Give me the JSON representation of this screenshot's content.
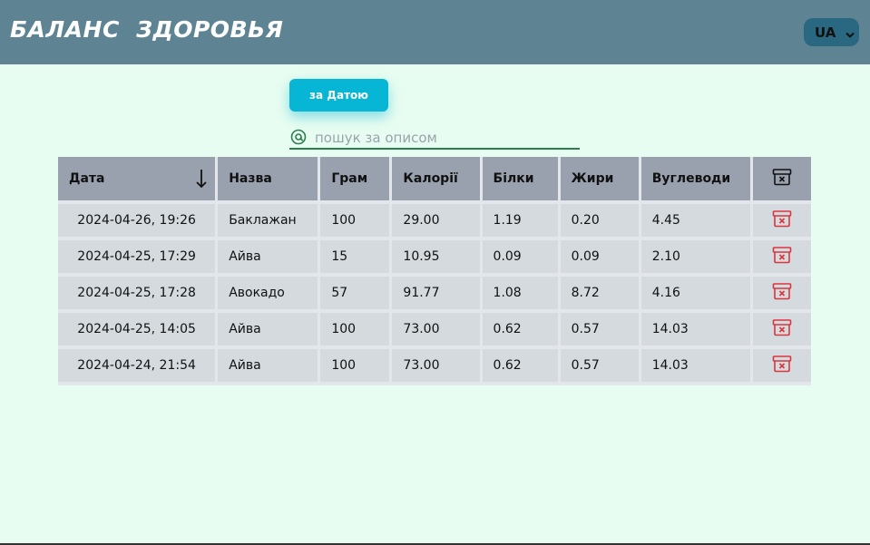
{
  "header": {
    "title": "БАЛАНС  ЗДОРОВЬЯ",
    "lang": "UA"
  },
  "controls": {
    "sort_button": "за Датою",
    "search_placeholder": "пошук за описом"
  },
  "table": {
    "columns": [
      "Дата",
      "Назва",
      "Грам",
      "Калорії",
      "Білки",
      "Жири",
      "Вуглеводи"
    ],
    "rows": [
      [
        "2024-04-26, 19:26",
        "Баклажан",
        "100",
        "29.00",
        "1.19",
        "0.20",
        "4.45"
      ],
      [
        "2024-04-25, 17:29",
        "Айва",
        "15",
        "10.95",
        "0.09",
        "0.09",
        "2.10"
      ],
      [
        "2024-04-25, 17:28",
        "Авокадо",
        "57",
        "91.77",
        "1.08",
        "8.72",
        "4.16"
      ],
      [
        "2024-04-25, 14:05",
        "Айва",
        "100",
        "73.00",
        "0.62",
        "0.57",
        "14.03"
      ],
      [
        "2024-04-24, 21:54",
        "Айва",
        "100",
        "73.00",
        "0.62",
        "0.57",
        "14.03"
      ]
    ]
  },
  "colors": {
    "header_bg": "#5e8493",
    "accent": "#06b6d4",
    "delete": "#d9363e",
    "page_bg": "#e8fdf1"
  },
  "icons": {
    "sort": "arrow-down-icon",
    "delete_all": "archive-x-icon",
    "delete_row": "archive-x-icon",
    "search": "at-sign-icon"
  }
}
